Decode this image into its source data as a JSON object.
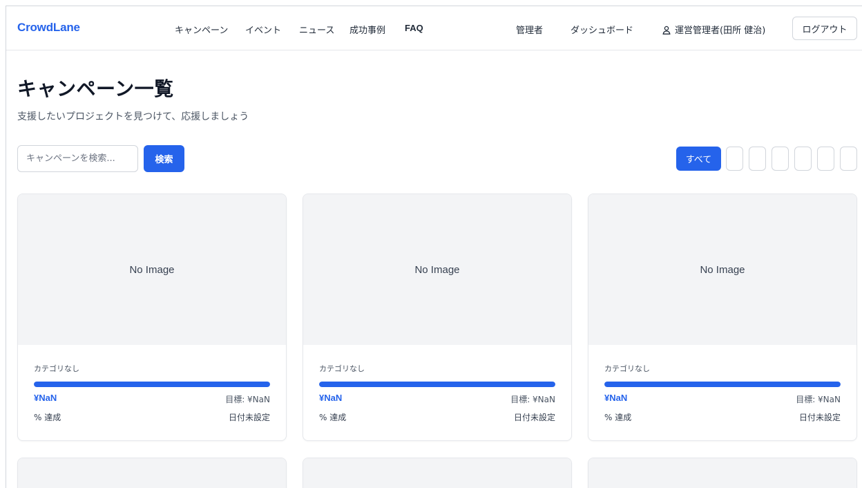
{
  "header": {
    "logo": "CrowdLane",
    "nav": [
      "キャンペーン",
      "イベント",
      "ニュース",
      "成功事例",
      "FAQ"
    ],
    "admin_link": "管理者",
    "dashboard_link": "ダッシュボード",
    "user_icon": "user-icon",
    "user_name": "運営管理者(田所 健治)",
    "logout": "ログアウト"
  },
  "page": {
    "title": "キャンペーン一覧",
    "subtitle": "支援したいプロジェクトを見つけて、応援しましょう"
  },
  "search": {
    "placeholder": "キャンペーンを検索...",
    "value": "",
    "button": "検索"
  },
  "filters": {
    "all_label": "すべて",
    "empty_count": 6
  },
  "colors": {
    "accent": "#2563eb",
    "image_bg": "#f3f4f6",
    "border": "#e5e7eb"
  },
  "cards": [
    {
      "image": "No Image",
      "category": "カテゴリなし",
      "progress": 1.0,
      "raised": "¥NaN",
      "goal": "目標: ¥NaN",
      "percent": "% 達成",
      "date": "日付未設定"
    },
    {
      "image": "No Image",
      "category": "カテゴリなし",
      "progress": 1.0,
      "raised": "¥NaN",
      "goal": "目標: ¥NaN",
      "percent": "% 達成",
      "date": "日付未設定"
    },
    {
      "image": "No Image",
      "category": "カテゴリなし",
      "progress": 1.0,
      "raised": "¥NaN",
      "goal": "目標: ¥NaN",
      "percent": "% 達成",
      "date": "日付未設定"
    }
  ]
}
